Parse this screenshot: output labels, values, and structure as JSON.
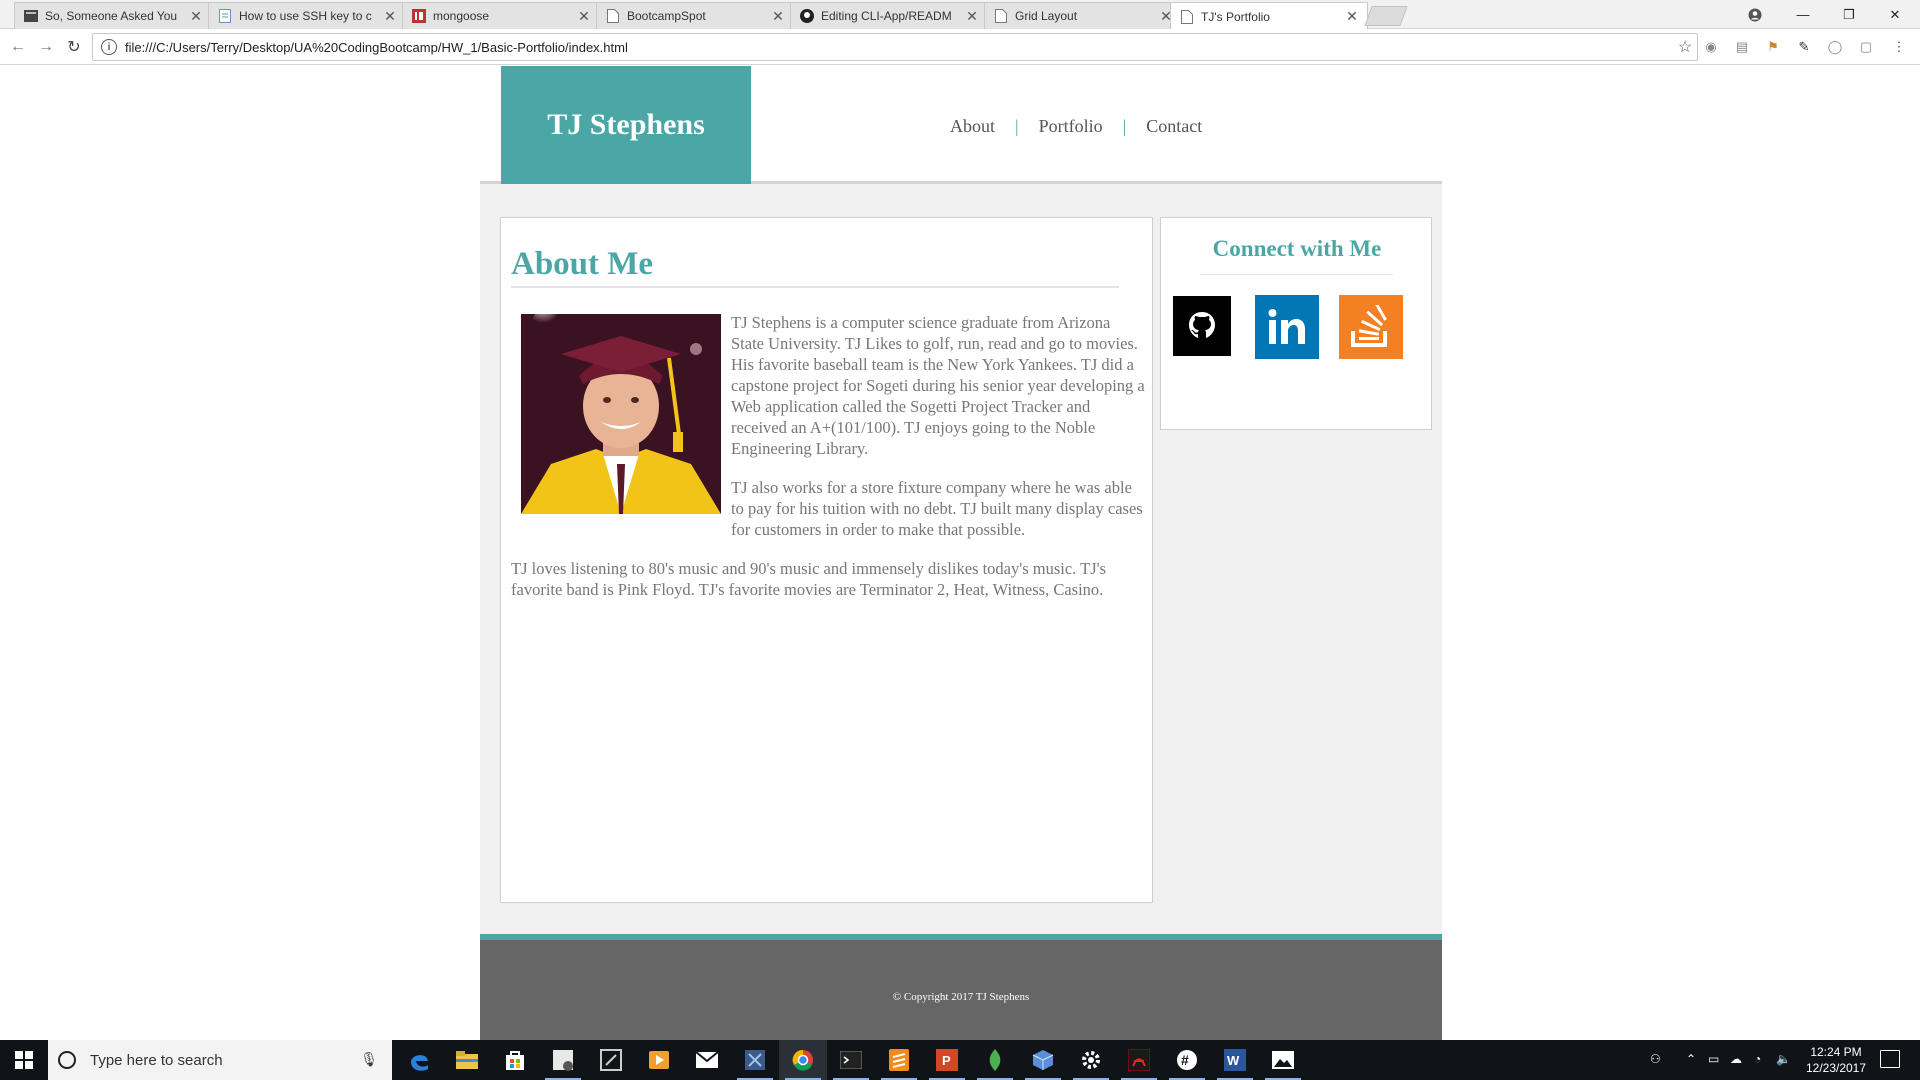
{
  "browser": {
    "tabs": [
      {
        "title": "So, Someone Asked You",
        "icon": "book-icon"
      },
      {
        "title": "How to use SSH key to c",
        "icon": "doc-icon"
      },
      {
        "title": "mongoose",
        "icon": "mongoose-icon"
      },
      {
        "title": "BootcampSpot",
        "icon": "page-icon"
      },
      {
        "title": "Editing CLI-App/READM",
        "icon": "github-icon"
      },
      {
        "title": "Grid Layout",
        "icon": "page-icon"
      },
      {
        "title": "TJ's Portfolio",
        "icon": "page-icon"
      }
    ],
    "active_tab_index": 6,
    "url": "file:///C:/Users/Terry/Desktop/UA%20CodingBootcamp/HW_1/Basic-Portfolio/index.html"
  },
  "site": {
    "brand": "TJ Stephens",
    "nav": [
      "About",
      "Portfolio",
      "Contact"
    ],
    "about": {
      "title": "About Me",
      "paragraphs": [
        "TJ Stephens is a computer science graduate from Arizona State University. TJ Likes to golf, run, read and go to movies. His favorite baseball team is the New York Yankees. TJ did a capstone project for Sogeti during his senior year developing a Web application called the Sogetti Project Tracker and received an A+(101/100). TJ enjoys going to the Noble Engineering Library.",
        "TJ also works for a store fixture company where he was able to pay for his tuition with no debt. TJ built many display cases for customers in order to make that possible.",
        "TJ loves listening to 80's music and 90's music and immensely dislikes today's music. TJ's favorite band is Pink Floyd. TJ's favorite movies are Terminator 2, Heat, Witness, Casino."
      ]
    },
    "connect": {
      "title": "Connect with Me",
      "links": [
        {
          "icon": "github-icon",
          "color": "#000000"
        },
        {
          "icon": "linkedin-icon",
          "color": "#0077b5"
        },
        {
          "icon": "stackoverflow-icon",
          "color": "#f48024"
        }
      ]
    },
    "footer": "© Copyright 2017 TJ Stephens",
    "accent": "#4aa7a5"
  },
  "taskbar": {
    "search_placeholder": "Type here to search",
    "time": "12:24 PM",
    "date": "12/23/2017"
  }
}
